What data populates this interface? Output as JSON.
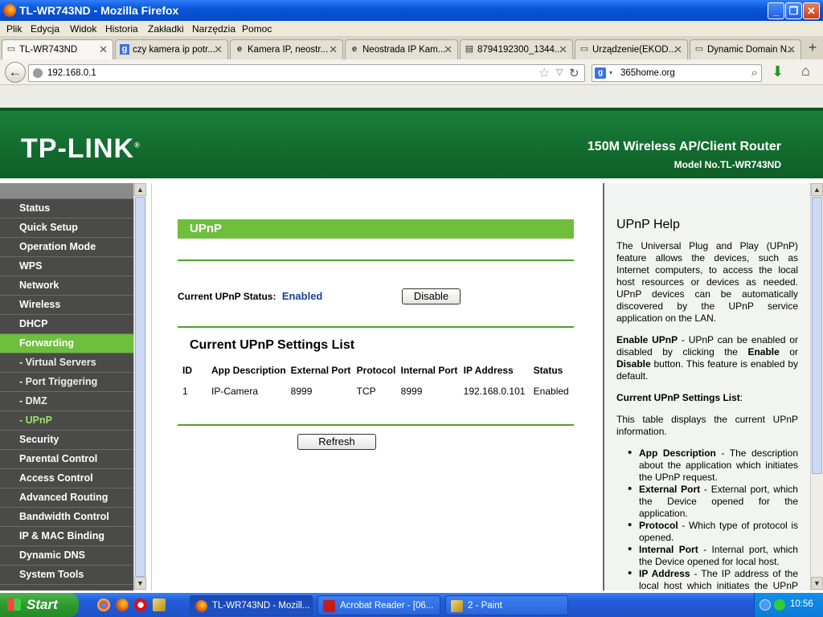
{
  "window": {
    "title": "TL-WR743ND - Mozilla Firefox"
  },
  "menu": [
    "Plik",
    "Edycja",
    "Widok",
    "Historia",
    "Zakładki",
    "Narzędzia",
    "Pomoc"
  ],
  "tabs": [
    {
      "label": "TL-WR743ND",
      "icon": "page-icon"
    },
    {
      "label": "czy kamera ip potr...",
      "icon": "google-icon"
    },
    {
      "label": "Kamera IP, neostr...",
      "icon": "ie-icon"
    },
    {
      "label": "Neostrada IP Kam...",
      "icon": "ie-icon"
    },
    {
      "label": "8794192300_1344...",
      "icon": "image-icon"
    },
    {
      "label": "Urządzenie(EKOD...",
      "icon": "page-icon"
    },
    {
      "label": "Dynamic Domain N...",
      "icon": "page-icon"
    }
  ],
  "nav": {
    "url": "192.168.0.1",
    "search": "365home.org"
  },
  "router": {
    "logo": "TP-LINK",
    "product": "150M Wireless AP/Client Router",
    "model": "Model No.TL-WR743ND"
  },
  "sidebar": [
    {
      "label": "Status",
      "type": "main"
    },
    {
      "label": "Quick Setup",
      "type": "main"
    },
    {
      "label": "Operation Mode",
      "type": "main"
    },
    {
      "label": "WPS",
      "type": "main"
    },
    {
      "label": "Network",
      "type": "main"
    },
    {
      "label": "Wireless",
      "type": "main"
    },
    {
      "label": "DHCP",
      "type": "main"
    },
    {
      "label": "Forwarding",
      "type": "active"
    },
    {
      "label": "- Virtual Servers",
      "type": "sub"
    },
    {
      "label": "- Port Triggering",
      "type": "sub"
    },
    {
      "label": "- DMZ",
      "type": "sub"
    },
    {
      "label": "- UPnP",
      "type": "subactive"
    },
    {
      "label": "Security",
      "type": "main"
    },
    {
      "label": "Parental Control",
      "type": "main"
    },
    {
      "label": "Access Control",
      "type": "main"
    },
    {
      "label": "Advanced Routing",
      "type": "main"
    },
    {
      "label": "Bandwidth Control",
      "type": "main"
    },
    {
      "label": "IP & MAC Binding",
      "type": "main"
    },
    {
      "label": "Dynamic DNS",
      "type": "main"
    },
    {
      "label": "System Tools",
      "type": "main"
    }
  ],
  "main": {
    "title": "UPnP",
    "status_label": "Current UPnP Status:",
    "status_value": "Enabled",
    "disable_button": "Disable",
    "list_title": "Current UPnP Settings List",
    "table": {
      "headers": [
        "ID",
        "App Description",
        "External Port",
        "Protocol",
        "Internal Port",
        "IP Address",
        "Status"
      ],
      "rows": [
        [
          "1",
          "IP-Camera",
          "8999",
          "TCP",
          "8999",
          "192.168.0.101",
          "Enabled"
        ]
      ]
    },
    "refresh_button": "Refresh"
  },
  "help": {
    "title": "UPnP Help",
    "intro": "The Universal Plug and Play (UPnP) feature allows the devices, such as Internet computers, to access the local host resources or devices as needed. UPnP devices can be automatically discovered by the UPnP service application on the LAN.",
    "enable_term": "Enable UPnP",
    "enable_text1": " - UPnP can be enabled or disabled by clicking the ",
    "enable_b1": "Enable",
    "enable_text2": " or ",
    "enable_b2": "Disable",
    "enable_text3": " button. This feature is enabled by default.",
    "list_term": "Current UPnP Settings List",
    "list_colon": ":",
    "table_text": "This table displays the current UPnP information.",
    "items": [
      {
        "term": "App Description",
        "text": " - The description about the application which initiates the UPnP request."
      },
      {
        "term": "External Port",
        "text": " - External port, which the Device opened for the application."
      },
      {
        "term": "Protocol",
        "text": " - Which type of protocol is opened."
      },
      {
        "term": "Internal Port",
        "text": " - Internal port, which the Device opened for local host."
      },
      {
        "term": "IP Address",
        "text": " - The IP address of the local host which initiates the UPnP request."
      }
    ]
  },
  "taskbar": {
    "start": "Start",
    "items": [
      {
        "label": "TL-WR743ND - Mozill...",
        "icon": "firefox-icon",
        "active": true
      },
      {
        "label": "Acrobat Reader - [06...",
        "icon": "acrobat-icon",
        "active": false
      },
      {
        "label": "2 - Paint",
        "icon": "paint-icon",
        "active": false
      }
    ],
    "time": "10:56"
  },
  "colors": {
    "accent_green": "#6ebf3c",
    "banner_green": "#136e2f",
    "status_blue": "#1d3f9b",
    "xp_blue": "#245edb"
  }
}
